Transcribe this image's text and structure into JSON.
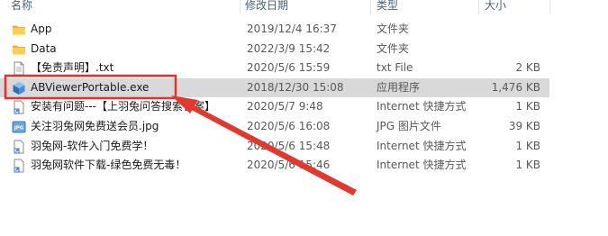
{
  "header": {
    "name": "名称",
    "date": "修改日期",
    "type": "类型",
    "size": "大小"
  },
  "files": [
    {
      "name": "App",
      "date": "2019/12/4 16:37",
      "type": "文件夹",
      "size": "",
      "icon": "folder-icon"
    },
    {
      "name": "Data",
      "date": "2022/3/9 15:42",
      "type": "文件夹",
      "size": "",
      "icon": "folder-icon"
    },
    {
      "name": "【免责声明】.txt",
      "date": "2020/5/6 15:59",
      "type": "txt File",
      "size": "2 KB",
      "icon": "text-file-icon"
    },
    {
      "name": "ABViewerPortable.exe",
      "date": "2018/12/30 15:08",
      "type": "应用程序",
      "size": "1,476 KB",
      "icon": "application-icon",
      "selected": true
    },
    {
      "name": "安装有问题---【上羽兔问答搜索答案】",
      "date": "2020/5/7 9:48",
      "type": "Internet 快捷方式",
      "size": "1 KB",
      "icon": "internet-shortcut-icon"
    },
    {
      "name": "关注羽兔网免费送会员.jpg",
      "date": "2020/5/6 16:08",
      "type": "JPG 图片文件",
      "size": "39 KB",
      "icon": "jpg-file-icon"
    },
    {
      "name": "羽兔网-软件入门免费学！",
      "date": "2020/5/6 15:48",
      "type": "Internet 快捷方式",
      "size": "1 KB",
      "icon": "internet-shortcut-icon"
    },
    {
      "name": "羽兔网软件下载-绿色免费无毒！",
      "date": "2020/5/6 15:46",
      "type": "Internet 快捷方式",
      "size": "1 KB",
      "icon": "internet-shortcut-icon"
    }
  ],
  "colors": {
    "highlight_box": "#e8302a",
    "arrow": "#e03a30",
    "selected_row": "#d9d9d9",
    "folder": "#f5c542"
  }
}
